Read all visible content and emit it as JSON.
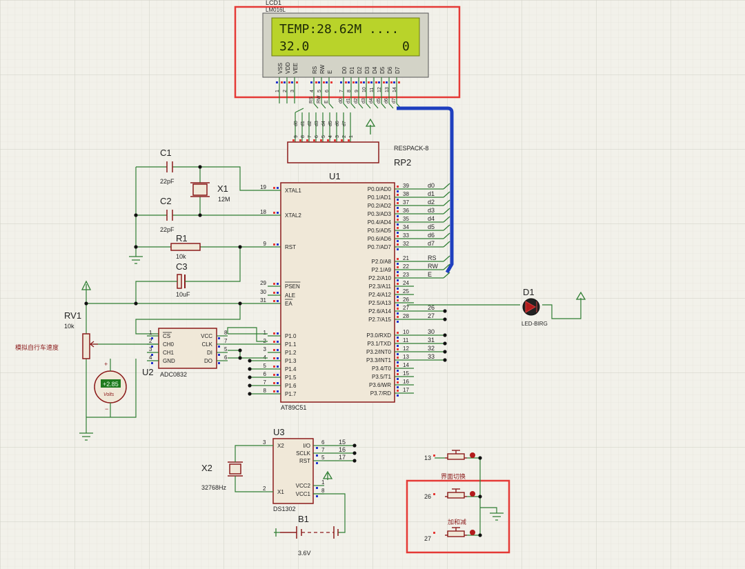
{
  "colors": {
    "background": "#f2f1ea",
    "grid": "#dcdcd4",
    "wire": "#2e7d32",
    "component": "#8b1a1a",
    "bus": "#1f3fbf",
    "highlight": "#e53935",
    "lcd_screen": "#b9d32a",
    "pin_red": "#e53935",
    "pin_blue": "#2233cc"
  },
  "lcd": {
    "ref": "LCD1",
    "model": "LM016L",
    "line1": "TEMP:28.62M ....",
    "line2_left": "32.0",
    "line2_right": "0",
    "pins": [
      "VSS",
      "VDD",
      "VEE",
      "RS",
      "RW",
      "E",
      "D0",
      "D1",
      "D2",
      "D3",
      "D4",
      "D5",
      "D6",
      "D7"
    ],
    "pin_numbers": [
      "1",
      "2",
      "3",
      "4",
      "5",
      "6",
      "7",
      "8",
      "9",
      "10",
      "11",
      "12",
      "13",
      "14"
    ]
  },
  "rp2": {
    "ref": "RP2",
    "model": "RESPACK-8",
    "pins": [
      "9",
      "8",
      "7",
      "6",
      "5",
      "4",
      "3",
      "2",
      "1"
    ],
    "nets": [
      "d0",
      "d1",
      "d2",
      "d3",
      "d4",
      "d5",
      "d6",
      "d7"
    ]
  },
  "u1": {
    "ref": "U1",
    "model": "AT89C51",
    "left_pins": [
      {
        "num": "19",
        "name": "XTAL1"
      },
      {
        "num": "18",
        "name": "XTAL2"
      },
      {
        "num": "9",
        "name": "RST"
      },
      {
        "num": "29",
        "name": "PSEN"
      },
      {
        "num": "30",
        "name": "ALE"
      },
      {
        "num": "31",
        "name": "EA"
      },
      {
        "num": "1",
        "name": "P1.0"
      },
      {
        "num": "2",
        "name": "P1.1"
      },
      {
        "num": "3",
        "name": "P1.2"
      },
      {
        "num": "4",
        "name": "P1.3"
      },
      {
        "num": "5",
        "name": "P1.4"
      },
      {
        "num": "6",
        "name": "P1.5"
      },
      {
        "num": "7",
        "name": "P1.6"
      },
      {
        "num": "8",
        "name": "P1.7"
      }
    ],
    "right_pins": [
      {
        "num": "39",
        "name": "P0.0/AD0",
        "net": "d0"
      },
      {
        "num": "38",
        "name": "P0.1/AD1",
        "net": "d1"
      },
      {
        "num": "37",
        "name": "P0.2/AD2",
        "net": "d2"
      },
      {
        "num": "36",
        "name": "P0.3/AD3",
        "net": "d3"
      },
      {
        "num": "35",
        "name": "P0.4/AD4",
        "net": "d4"
      },
      {
        "num": "34",
        "name": "P0.5/AD5",
        "net": "d5"
      },
      {
        "num": "33",
        "name": "P0.6/AD6",
        "net": "d6"
      },
      {
        "num": "32",
        "name": "P0.7/AD7",
        "net": "d7"
      },
      {
        "num": "21",
        "name": "P2.0/A8",
        "net": "RS"
      },
      {
        "num": "22",
        "name": "P2.1/A9",
        "net": "RW"
      },
      {
        "num": "23",
        "name": "P2.2/A10",
        "net": "E"
      },
      {
        "num": "24",
        "name": "P2.3/A11",
        "net": ""
      },
      {
        "num": "25",
        "name": "P2.4/A12",
        "net": ""
      },
      {
        "num": "26",
        "name": "P2.5/A13",
        "net": ""
      },
      {
        "num": "27",
        "name": "P2.6/A14",
        "net": "26"
      },
      {
        "num": "28",
        "name": "P2.7/A15",
        "net": "27"
      },
      {
        "num": "10",
        "name": "P3.0/RXD",
        "net": "30"
      },
      {
        "num": "11",
        "name": "P3.1/TXD",
        "net": "31"
      },
      {
        "num": "12",
        "name": "P3.2/INT0",
        "net": "32"
      },
      {
        "num": "13",
        "name": "P3.3/INT1",
        "net": "33"
      },
      {
        "num": "14",
        "name": "P3.4/T0",
        "net": ""
      },
      {
        "num": "15",
        "name": "P3.5/T1",
        "net": ""
      },
      {
        "num": "16",
        "name": "P3.6/WR",
        "net": ""
      },
      {
        "num": "17",
        "name": "P3.7/RD",
        "net": ""
      }
    ]
  },
  "c1": {
    "ref": "C1",
    "value": "22pF"
  },
  "c2": {
    "ref": "C2",
    "value": "22pF"
  },
  "c3": {
    "ref": "C3",
    "value": "10uF"
  },
  "x1": {
    "ref": "X1",
    "value": "12M"
  },
  "r1": {
    "ref": "R1",
    "value": "10k"
  },
  "rv1": {
    "ref": "RV1",
    "value": "10k",
    "label": "模拟自行车速度"
  },
  "voltmeter": {
    "reading": "+2.85",
    "unit": "Volts"
  },
  "u2": {
    "ref": "U2",
    "model": "ADC0832",
    "left_pins": [
      {
        "num": "1",
        "name": "CS"
      },
      {
        "num": "2",
        "name": "CH0"
      },
      {
        "num": "3",
        "name": "CH1"
      },
      {
        "num": "4",
        "name": "GND"
      }
    ],
    "right_pins": [
      {
        "num": "8",
        "name": "VCC"
      },
      {
        "num": "7",
        "name": "CLK"
      },
      {
        "num": "5",
        "name": "DI"
      },
      {
        "num": "6",
        "name": "DO"
      }
    ]
  },
  "u3": {
    "ref": "U3",
    "model": "DS1302",
    "left_pins": [
      {
        "num": "3",
        "name": "X2"
      },
      {
        "num": "2",
        "name": "X1"
      }
    ],
    "right_pins": [
      {
        "num": "6",
        "name": "I/O"
      },
      {
        "num": "7",
        "name": "SCLK"
      },
      {
        "num": "5",
        "name": "RST"
      },
      {
        "num": "1",
        "name": "VCC2"
      },
      {
        "num": "8",
        "name": "VCC1"
      }
    ],
    "nets": [
      "15",
      "16",
      "17"
    ]
  },
  "x2": {
    "ref": "X2",
    "value": "32768Hz"
  },
  "b1": {
    "ref": "B1",
    "value": "3.6V"
  },
  "d1": {
    "ref": "D1",
    "model": "LED-BIRG"
  },
  "buttons": {
    "btn1_net": "13",
    "btn2_net": "26",
    "btn3_net": "27",
    "label_switch": "界面切换",
    "label_adjust": "加和减"
  }
}
